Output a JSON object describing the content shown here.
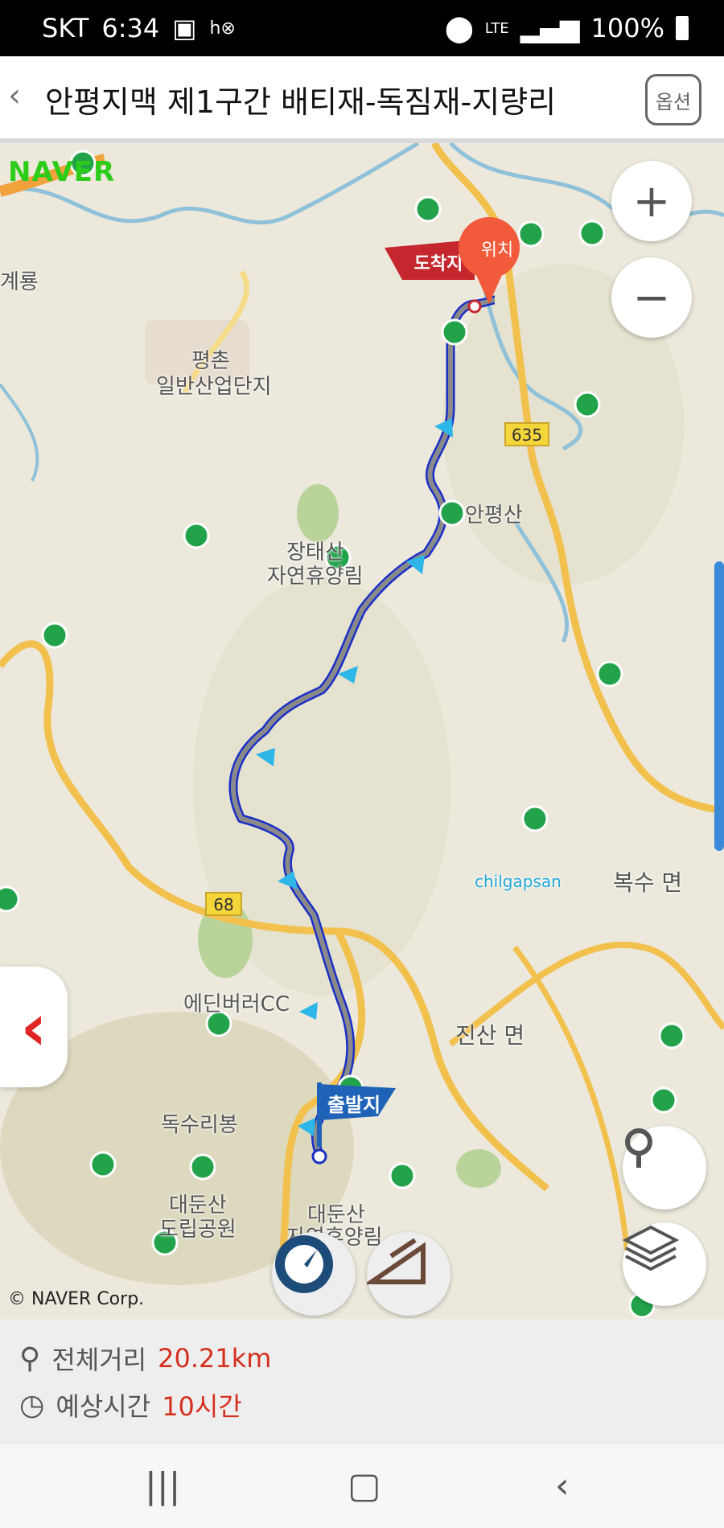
{
  "status": {
    "carrier": "SKT",
    "time": "6:34",
    "network": "LTE",
    "battery": "100%"
  },
  "header": {
    "title": "안평지맥 제1구간 배티재-독짐재-지량리",
    "option_label": "옵션"
  },
  "map": {
    "logo": "NAVER",
    "labels": {
      "gyeryong": "계룡",
      "pyeongchon": "평촌",
      "industrial": "일반산업단지",
      "jangtaesan1": "장태산",
      "jangtaesan2": "자연휴양림",
      "anpyeongsan": "안평산",
      "chilgapsan": "chilgapsan",
      "boksu": "복수 면",
      "jinsan": "진산 면",
      "edibury": "에딘버러CC",
      "doksuri": "독수리봉",
      "daedunsan1": "대둔산",
      "daedunsan2": "도립공원",
      "daedunsan3": "대둔산",
      "daedunsan4": "자연휴양림",
      "road635": "635",
      "road68": "68"
    },
    "markers": {
      "start": "출발지",
      "end": "도착지",
      "location": "위치"
    },
    "copyright": "© NAVER Corp."
  },
  "route": {
    "distance_label": "전체거리",
    "distance_value": "20.21km",
    "time_label": "예상시간",
    "time_value": "10시간"
  }
}
